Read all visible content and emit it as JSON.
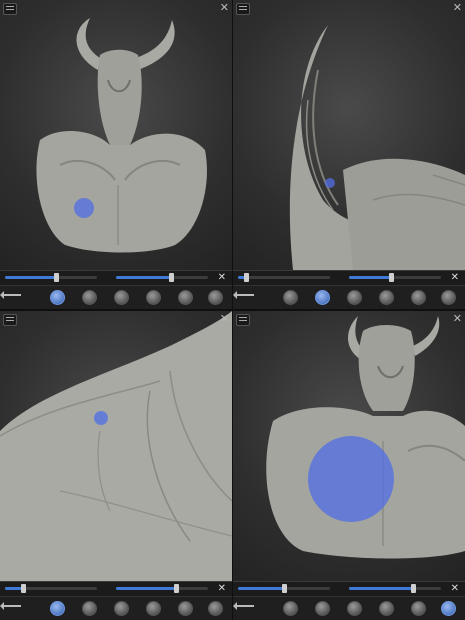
{
  "colors": {
    "accent": "#3f7ad6",
    "brush": "#5a72e6",
    "mesh": "#a8a9a3",
    "background": "#2e2e2e"
  },
  "panes": [
    {
      "view": "bust-front",
      "brush_size_pct": 9,
      "radius_level": 0.55,
      "intensity_level": 0.6,
      "active_tool": 0
    },
    {
      "view": "horn-closeup",
      "brush_size_pct": 4,
      "radius_level": 0.08,
      "intensity_level": 0.45,
      "active_tool": 2
    },
    {
      "view": "shoulder-closeup",
      "brush_size_pct": 6,
      "radius_level": 0.2,
      "intensity_level": 0.65,
      "active_tool": 0
    },
    {
      "view": "chest-large-brush",
      "brush_size_pct": 37,
      "radius_level": 0.5,
      "intensity_level": 0.7,
      "active_tool": 5
    }
  ],
  "toolbar": {
    "back_icon": "back-arrow-icon",
    "tools": [
      {
        "icon": "brush-tool-icon"
      },
      {
        "icon": "inflate-tool-icon"
      },
      {
        "icon": "smooth-tool-icon"
      },
      {
        "icon": "pinch-tool-icon"
      },
      {
        "icon": "flatten-tool-icon"
      },
      {
        "icon": "paint-tool-icon"
      }
    ]
  },
  "header": {
    "menu_icon": "hamburger-menu-icon",
    "close_icon": "close-icon",
    "close_glyph": "✕"
  },
  "symmetry": {
    "icon": "symmetry-icon",
    "glyph": "✕"
  }
}
